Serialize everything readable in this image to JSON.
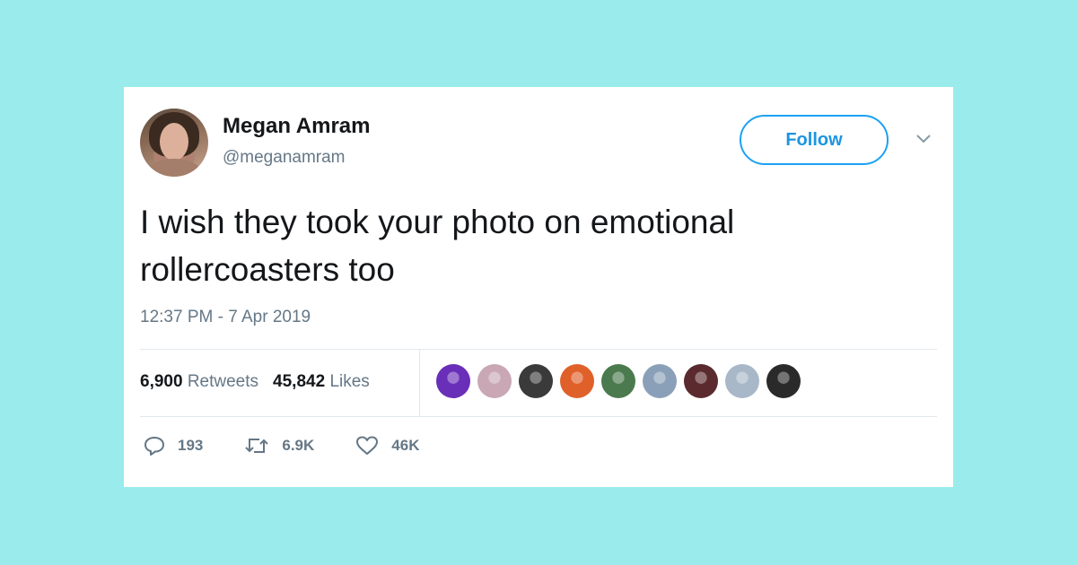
{
  "author": {
    "name": "Megan Amram",
    "handle": "@meganamram"
  },
  "follow_button": {
    "label": "Follow"
  },
  "tweet": {
    "text": "I wish they took your photo on emotional rollercoasters too",
    "timestamp": "12:37 PM - 7 Apr 2019"
  },
  "stats": {
    "retweets_count": "6,900",
    "retweets_label": "Retweets",
    "likes_count": "45,842",
    "likes_label": "Likes"
  },
  "likers": [
    {
      "color": "#6a2fb8"
    },
    {
      "color": "#c9a7b5"
    },
    {
      "color": "#3a3a3a"
    },
    {
      "color": "#e0602a"
    },
    {
      "color": "#4a7a4e"
    },
    {
      "color": "#8aa0b8"
    },
    {
      "color": "#5a2a2e"
    },
    {
      "color": "#a8b8c8"
    },
    {
      "color": "#2a2a2a"
    }
  ],
  "actions": {
    "replies": "193",
    "retweets": "6.9K",
    "likes": "46K"
  },
  "colors": {
    "background": "#9aecec",
    "accent": "#1da1f2",
    "muted": "#657786",
    "text": "#14171a"
  }
}
